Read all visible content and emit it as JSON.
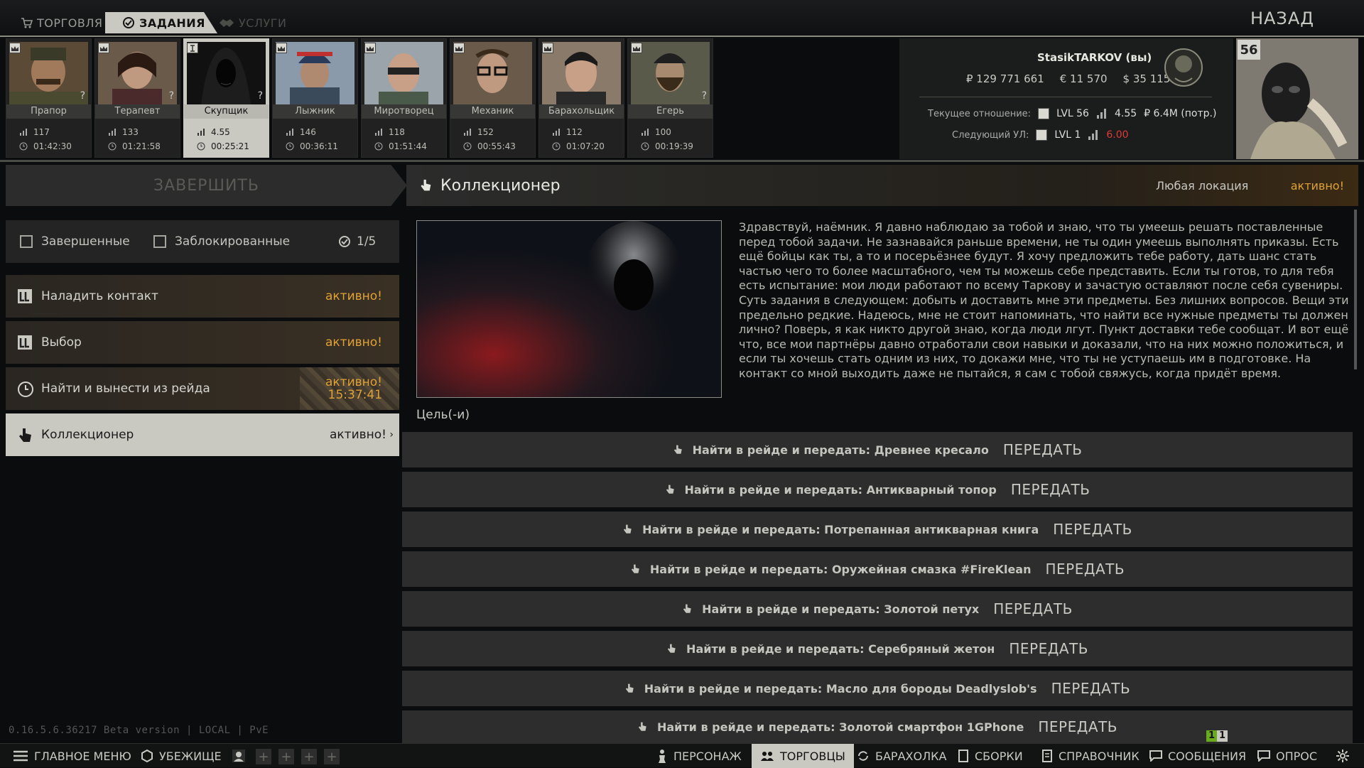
{
  "topbar": {
    "tabs": [
      {
        "label": "ТОРГОВЛЯ",
        "icon": "trade-cart-icon"
      },
      {
        "label": "ЗАДАНИЯ",
        "icon": "checkmark-circle-icon"
      },
      {
        "label": "УСЛУГИ",
        "icon": "handshake-icon"
      }
    ],
    "back_label": "НАЗАД"
  },
  "traders": [
    {
      "name": "Прапор",
      "level": "117",
      "timer": "01:42:30",
      "selected": false
    },
    {
      "name": "Терапевт",
      "level": "133",
      "timer": "01:21:58",
      "selected": false
    },
    {
      "name": "Скупщик",
      "level": "4.55",
      "timer": "00:25:21",
      "selected": true
    },
    {
      "name": "Лыжник",
      "level": "146",
      "timer": "00:36:11",
      "selected": false
    },
    {
      "name": "Миротворец",
      "level": "118",
      "timer": "01:51:44",
      "selected": false
    },
    {
      "name": "Механик",
      "level": "152",
      "timer": "00:55:43",
      "selected": false
    },
    {
      "name": "Барахольщик",
      "level": "112",
      "timer": "01:07:20",
      "selected": false
    },
    {
      "name": "Егерь",
      "level": "100",
      "timer": "00:19:39",
      "selected": false
    }
  ],
  "player": {
    "name": "StasikTARKOV (вы)",
    "roubles": "₽ 129 771 661",
    "euros": "€ 11 570",
    "dollars": "$ 35 115",
    "current_relation_label": "Текущее отношение:",
    "current_lvl": "LVL 56",
    "current_standing": "4.55",
    "current_spent": "₽ 6.4M (потр.)",
    "next_label": "Следующий УЛ:",
    "next_lvl": "LVL 1",
    "next_standing": "6.00",
    "level": "56"
  },
  "left_panel": {
    "finish_label": "ЗАВЕРШИТЬ",
    "filter_completed": "Завершенные",
    "filter_blocked": "Заблокированные",
    "count": "1/5",
    "quests": [
      {
        "name": "Наладить контакт",
        "status": "активно!",
        "timer": ""
      },
      {
        "name": "Выбор",
        "status": "активно!",
        "timer": ""
      },
      {
        "name": "Найти и вынести из рейда",
        "status": "активно!",
        "timer": "15:37:41"
      },
      {
        "name": "Коллекционер",
        "status": "активно!",
        "timer": ""
      }
    ],
    "version": "0.16.5.6.36217 Beta version | LOCAL | PvE"
  },
  "quest": {
    "title": "Коллекционер",
    "location": "Любая локация",
    "status": "активно!",
    "description": "Здравствуй, наёмник. Я давно наблюдаю за тобой и знаю, что ты умеешь решать поставленные перед тобой задачи. Не зазнавайся раньше времени, не ты один умеешь выполнять приказы. Есть ещё бойцы как ты, а то и посерьёзнее будут. Я хочу предложить тебе работу, дать шанс стать частью чего то более масштабного, чем ты можешь себе представить. Если ты готов, то для тебя есть испытание: мои люди работают по всему Таркову и зачастую оставляют после себя сувениры. Суть задания в следующем: добыть и доставить мне эти предметы. Без лишних вопросов. Вещи эти предельно редкие. Надеюсь, мне не стоит напоминать, что найти все нужные предметы ты должен лично? Поверь, я как никто другой знаю, когда люди лгут. Пункт доставки тебе сообщат. И вот ещё что, все мои партнёры давно отработали свои навыки и доказали, что на них можно положиться, и если ты хочешь стать одним из них, то докажи мне, что ты не уступаешь им в подготовке. На контакт со мной выходить даже не пытайся, я сам с тобой свяжусь, когда придёт время.",
    "goal_label": "Цель(-и)",
    "objectives": [
      {
        "text": "Найти в рейде и передать: Древнее кресало",
        "button": "ПЕРЕДАТЬ"
      },
      {
        "text": "Найти в рейде и передать: Антикварный топор",
        "button": "ПЕРЕДАТЬ"
      },
      {
        "text": "Найти в рейде и передать: Потрепанная антикварная книга",
        "button": "ПЕРЕДАТЬ"
      },
      {
        "text": "Найти в рейде и передать: Оружейная смазка #FireKlean",
        "button": "ПЕРЕДАТЬ"
      },
      {
        "text": "Найти в рейде и передать: Золотой петух",
        "button": "ПЕРЕДАТЬ"
      },
      {
        "text": "Найти в рейде и передать: Серебряный жетон",
        "button": "ПЕРЕДАТЬ"
      },
      {
        "text": "Найти в рейде и передать: Масло для бороды Deadlyslob's",
        "button": "ПЕРЕДАТЬ"
      },
      {
        "text": "Найти в рейде и передать: Золотой смартфон 1GPhone",
        "button": "ПЕРЕДАТЬ"
      }
    ]
  },
  "bottombar": {
    "main_menu": "ГЛАВНОЕ МЕНЮ",
    "hideout": "УБЕЖИЩЕ",
    "character": "ПЕРСОНАЖ",
    "traders": "ТОРГОВЦЫ",
    "flea": "БАРАХОЛКА",
    "builds": "СБОРКИ",
    "handbook": "СПРАВОЧНИК",
    "messages": "СООБЩЕНИЯ",
    "survey": "ОПРОС",
    "notif_a": "1",
    "notif_b": "1"
  },
  "colors": {
    "accent_orange": "#e0a235",
    "selected_bg": "#c9c8c1",
    "red_value": "#e03a3a"
  }
}
